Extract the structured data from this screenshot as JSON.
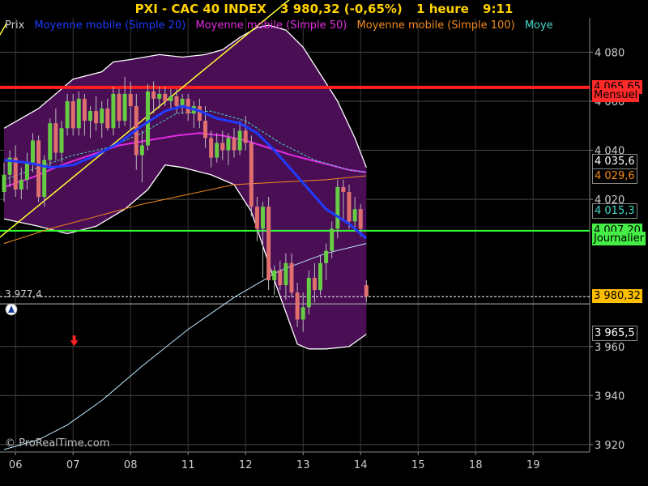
{
  "header": {
    "symbol": "PXI - CAC 40 INDEX",
    "price": "3 980,32 (-0,65%)",
    "timeframe": "1 heure",
    "time": "9:11"
  },
  "legend": {
    "items": [
      {
        "label": "Prix",
        "color": "#cccccc"
      },
      {
        "label": "Moyenne mobile (Simple 20)",
        "color": "#1f3cff"
      },
      {
        "label": "Moyenne mobile (Simple 50)",
        "color": "#e22be2"
      },
      {
        "label": "Moyenne mobile (Simple 100)",
        "color": "#f08a1e"
      },
      {
        "label": "Moye",
        "color": "#40d8c8"
      }
    ]
  },
  "copyright": "© ProRealTime.com",
  "price_labels": [
    {
      "text": "4 065,65",
      "value": 4065.65,
      "bg": "#ff2a2a",
      "fg": "#000000"
    },
    {
      "text": "Mensuel",
      "value": 4062.3,
      "bg": "#ff2a2a",
      "fg": "#000000"
    },
    {
      "text": "4 035,6",
      "value": 4035.6,
      "bg": "#000000",
      "fg": "#ffffff"
    },
    {
      "text": "4 029,6",
      "value": 4029.6,
      "bg": "#000000",
      "fg": "#f08a1e"
    },
    {
      "text": "4 015,3",
      "value": 4015.3,
      "bg": "#000000",
      "fg": "#40d8c8"
    },
    {
      "text": "4 007,20",
      "value": 4007.2,
      "bg": "#44ee44",
      "fg": "#000000"
    },
    {
      "text": "Journalier",
      "value": 4003.9,
      "bg": "#44ee44",
      "fg": "#000000"
    },
    {
      "text": "3 980,32",
      "value": 3980.32,
      "bg": "#ffbf00",
      "fg": "#000000"
    },
    {
      "text": "3 965,5",
      "value": 3965.5,
      "bg": "#000000",
      "fg": "#ffffff"
    }
  ],
  "left_marker": "3 977,4",
  "chart_data": {
    "type": "candlestick",
    "title": "PXI - CAC 40 INDEX",
    "ylim": [
      3917,
      4094
    ],
    "y_ticks": [
      3920,
      3940,
      3960,
      4020,
      4040,
      4060,
      4080
    ],
    "y_tick_labels": [
      "3 920",
      "3 940",
      "3 960",
      "4 020",
      "4 040",
      "4 060",
      "4 080"
    ],
    "x_ticks": [
      {
        "label": "06",
        "idx": 2
      },
      {
        "label": "07",
        "idx": 12
      },
      {
        "label": "08",
        "idx": 22
      },
      {
        "label": "11",
        "idx": 32
      },
      {
        "label": "12",
        "idx": 42
      },
      {
        "label": "13",
        "idx": 52
      },
      {
        "label": "14",
        "idx": 62
      },
      {
        "label": "15",
        "idx": 72
      },
      {
        "label": "18",
        "idx": 82
      },
      {
        "label": "19",
        "idx": 92
      }
    ],
    "candles": [
      {
        "o": 4023,
        "h": 4035,
        "l": 4019,
        "c": 4030
      },
      {
        "o": 4030,
        "h": 4040,
        "l": 4025,
        "c": 4037
      },
      {
        "o": 4037,
        "h": 4042,
        "l": 4021,
        "c": 4024
      },
      {
        "o": 4024,
        "h": 4033,
        "l": 4020,
        "c": 4028
      },
      {
        "o": 4028,
        "h": 4039,
        "l": 4024,
        "c": 4035
      },
      {
        "o": 4035,
        "h": 4047,
        "l": 4031,
        "c": 4044
      },
      {
        "o": 4044,
        "h": 4046,
        "l": 4019,
        "c": 4021
      },
      {
        "o": 4021,
        "h": 4038,
        "l": 4017,
        "c": 4036
      },
      {
        "o": 4036,
        "h": 4053,
        "l": 4033,
        "c": 4051
      },
      {
        "o": 4051,
        "h": 4057,
        "l": 4036,
        "c": 4039
      },
      {
        "o": 4039,
        "h": 4052,
        "l": 4035,
        "c": 4049
      },
      {
        "o": 4049,
        "h": 4063,
        "l": 4046,
        "c": 4060
      },
      {
        "o": 4060,
        "h": 4063,
        "l": 4046,
        "c": 4049
      },
      {
        "o": 4049,
        "h": 4064,
        "l": 4046,
        "c": 4061
      },
      {
        "o": 4061,
        "h": 4063,
        "l": 4046,
        "c": 4052
      },
      {
        "o": 4052,
        "h": 4058,
        "l": 4045,
        "c": 4056
      },
      {
        "o": 4056,
        "h": 4062,
        "l": 4048,
        "c": 4051
      },
      {
        "o": 4051,
        "h": 4060,
        "l": 4045,
        "c": 4057
      },
      {
        "o": 4057,
        "h": 4061,
        "l": 4048,
        "c": 4049
      },
      {
        "o": 4049,
        "h": 4066,
        "l": 4046,
        "c": 4063
      },
      {
        "o": 4063,
        "h": 4065,
        "l": 4049,
        "c": 4052
      },
      {
        "o": 4052,
        "h": 4070,
        "l": 4050,
        "c": 4063
      },
      {
        "o": 4063,
        "h": 4068,
        "l": 4048,
        "c": 4058
      },
      {
        "o": 4058,
        "h": 4063,
        "l": 4032,
        "c": 4038
      },
      {
        "o": 4038,
        "h": 4048,
        "l": 4027,
        "c": 4042
      },
      {
        "o": 4042,
        "h": 4067,
        "l": 4040,
        "c": 4064
      },
      {
        "o": 4064,
        "h": 4068,
        "l": 4055,
        "c": 4061
      },
      {
        "o": 4061,
        "h": 4066,
        "l": 4057,
        "c": 4063
      },
      {
        "o": 4063,
        "h": 4066,
        "l": 4058,
        "c": 4060
      },
      {
        "o": 4060,
        "h": 4065,
        "l": 4057,
        "c": 4062
      },
      {
        "o": 4062,
        "h": 4065,
        "l": 4055,
        "c": 4058
      },
      {
        "o": 4058,
        "h": 4063,
        "l": 4055,
        "c": 4061
      },
      {
        "o": 4061,
        "h": 4063,
        "l": 4052,
        "c": 4055
      },
      {
        "o": 4055,
        "h": 4060,
        "l": 4049,
        "c": 4058
      },
      {
        "o": 4058,
        "h": 4061,
        "l": 4049,
        "c": 4052
      },
      {
        "o": 4052,
        "h": 4058,
        "l": 4041,
        "c": 4045
      },
      {
        "o": 4045,
        "h": 4048,
        "l": 4033,
        "c": 4037
      },
      {
        "o": 4037,
        "h": 4047,
        "l": 4035,
        "c": 4043
      },
      {
        "o": 4043,
        "h": 4048,
        "l": 4036,
        "c": 4040
      },
      {
        "o": 4040,
        "h": 4047,
        "l": 4034,
        "c": 4045
      },
      {
        "o": 4045,
        "h": 4049,
        "l": 4037,
        "c": 4040
      },
      {
        "o": 4040,
        "h": 4052,
        "l": 4038,
        "c": 4048
      },
      {
        "o": 4048,
        "h": 4054,
        "l": 4040,
        "c": 4043
      },
      {
        "o": 4043,
        "h": 4046,
        "l": 4013,
        "c": 4017
      },
      {
        "o": 4017,
        "h": 4021,
        "l": 4003,
        "c": 4008
      },
      {
        "o": 4008,
        "h": 4019,
        "l": 3988,
        "c": 4017
      },
      {
        "o": 4017,
        "h": 4021,
        "l": 3983,
        "c": 3987
      },
      {
        "o": 3987,
        "h": 3993,
        "l": 3981,
        "c": 3991
      },
      {
        "o": 3991,
        "h": 3995,
        "l": 3983,
        "c": 3985
      },
      {
        "o": 3985,
        "h": 3998,
        "l": 3979,
        "c": 3994
      },
      {
        "o": 3994,
        "h": 3998,
        "l": 3980,
        "c": 3982
      },
      {
        "o": 3982,
        "h": 3986,
        "l": 3968,
        "c": 3971
      },
      {
        "o": 3971,
        "h": 3982,
        "l": 3966,
        "c": 3976
      },
      {
        "o": 3976,
        "h": 3991,
        "l": 3973,
        "c": 3988
      },
      {
        "o": 3988,
        "h": 3994,
        "l": 3978,
        "c": 3983
      },
      {
        "o": 3983,
        "h": 3997,
        "l": 3981,
        "c": 3994
      },
      {
        "o": 3994,
        "h": 4002,
        "l": 3987,
        "c": 3999
      },
      {
        "o": 3999,
        "h": 4011,
        "l": 3996,
        "c": 4008
      },
      {
        "o": 4008,
        "h": 4028,
        "l": 4004,
        "c": 4025
      },
      {
        "o": 4025,
        "h": 4028,
        "l": 4012,
        "c": 4023
      },
      {
        "o": 4023,
        "h": 4026,
        "l": 4008,
        "c": 4011
      },
      {
        "o": 4011,
        "h": 4021,
        "l": 4007,
        "c": 4016
      },
      {
        "o": 4016,
        "h": 4018,
        "l": 4005,
        "c": 4008
      },
      {
        "o": 3985,
        "h": 3987,
        "l": 3978,
        "c": 3980.32
      }
    ],
    "bollinger_upper": [
      {
        "i": 0,
        "v": 4049
      },
      {
        "i": 6,
        "v": 4057
      },
      {
        "i": 12,
        "v": 4069
      },
      {
        "i": 17,
        "v": 4072
      },
      {
        "i": 19,
        "v": 4076
      },
      {
        "i": 22,
        "v": 4077
      },
      {
        "i": 27,
        "v": 4079
      },
      {
        "i": 31,
        "v": 4078
      },
      {
        "i": 35,
        "v": 4079
      },
      {
        "i": 38,
        "v": 4081
      },
      {
        "i": 41,
        "v": 4086
      },
      {
        "i": 44,
        "v": 4090
      },
      {
        "i": 46,
        "v": 4091
      },
      {
        "i": 49,
        "v": 4089
      },
      {
        "i": 52,
        "v": 4082
      },
      {
        "i": 55,
        "v": 4071
      },
      {
        "i": 58,
        "v": 4060
      },
      {
        "i": 61,
        "v": 4045
      },
      {
        "i": 63,
        "v": 4033
      }
    ],
    "bollinger_lower": [
      {
        "i": 0,
        "v": 4012
      },
      {
        "i": 6,
        "v": 4009
      },
      {
        "i": 11,
        "v": 4006
      },
      {
        "i": 16,
        "v": 4009
      },
      {
        "i": 21,
        "v": 4016
      },
      {
        "i": 25,
        "v": 4024
      },
      {
        "i": 28,
        "v": 4034
      },
      {
        "i": 31,
        "v": 4033
      },
      {
        "i": 36,
        "v": 4030
      },
      {
        "i": 40,
        "v": 4026
      },
      {
        "i": 43,
        "v": 4015
      },
      {
        "i": 45,
        "v": 4001
      },
      {
        "i": 47,
        "v": 3987
      },
      {
        "i": 49,
        "v": 3974
      },
      {
        "i": 51,
        "v": 3961
      },
      {
        "i": 53,
        "v": 3959
      },
      {
        "i": 56,
        "v": 3959
      },
      {
        "i": 60,
        "v": 3960
      },
      {
        "i": 63,
        "v": 3965
      }
    ],
    "ma20": [
      {
        "i": 0,
        "v": 4036
      },
      {
        "i": 4,
        "v": 4035
      },
      {
        "i": 8,
        "v": 4033
      },
      {
        "i": 12,
        "v": 4034
      },
      {
        "i": 16,
        "v": 4038
      },
      {
        "i": 20,
        "v": 4043
      },
      {
        "i": 24,
        "v": 4050
      },
      {
        "i": 28,
        "v": 4056
      },
      {
        "i": 31,
        "v": 4058
      },
      {
        "i": 34,
        "v": 4056
      },
      {
        "i": 37,
        "v": 4053
      },
      {
        "i": 41,
        "v": 4051
      },
      {
        "i": 44,
        "v": 4047
      },
      {
        "i": 47,
        "v": 4040
      },
      {
        "i": 50,
        "v": 4032
      },
      {
        "i": 53,
        "v": 4024
      },
      {
        "i": 56,
        "v": 4016
      },
      {
        "i": 60,
        "v": 4010
      },
      {
        "i": 63,
        "v": 4004
      }
    ],
    "ma50": [
      {
        "i": 0,
        "v": 4025
      },
      {
        "i": 5,
        "v": 4029
      },
      {
        "i": 10,
        "v": 4034
      },
      {
        "i": 15,
        "v": 4038
      },
      {
        "i": 20,
        "v": 4042
      },
      {
        "i": 25,
        "v": 4044
      },
      {
        "i": 30,
        "v": 4046
      },
      {
        "i": 34,
        "v": 4047
      },
      {
        "i": 38,
        "v": 4046
      },
      {
        "i": 42,
        "v": 4044
      },
      {
        "i": 46,
        "v": 4041
      },
      {
        "i": 50,
        "v": 4038
      },
      {
        "i": 55,
        "v": 4035
      },
      {
        "i": 60,
        "v": 4032
      },
      {
        "i": 63,
        "v": 4031
      }
    ],
    "ma100": [
      {
        "i": 0,
        "v": 4002
      },
      {
        "i": 8,
        "v": 4008
      },
      {
        "i": 16,
        "v": 4013
      },
      {
        "i": 24,
        "v": 4018
      },
      {
        "i": 32,
        "v": 4022
      },
      {
        "i": 40,
        "v": 4026
      },
      {
        "i": 48,
        "v": 4027
      },
      {
        "i": 56,
        "v": 4028
      },
      {
        "i": 63,
        "v": 4029.6
      }
    ],
    "ma_cyan": [
      {
        "i": 0,
        "v": 3918
      },
      {
        "i": 6,
        "v": 3922
      },
      {
        "i": 11,
        "v": 3928
      },
      {
        "i": 17,
        "v": 3938
      },
      {
        "i": 24,
        "v": 3952
      },
      {
        "i": 32,
        "v": 3967
      },
      {
        "i": 40,
        "v": 3980
      },
      {
        "i": 48,
        "v": 3991
      },
      {
        "i": 56,
        "v": 3998
      },
      {
        "i": 63,
        "v": 4002
      }
    ],
    "ma_dashed": [
      {
        "i": 0,
        "v": 4028
      },
      {
        "i": 6,
        "v": 4033
      },
      {
        "i": 12,
        "v": 4038
      },
      {
        "i": 18,
        "v": 4041
      },
      {
        "i": 24,
        "v": 4047
      },
      {
        "i": 30,
        "v": 4055
      },
      {
        "i": 36,
        "v": 4056
      },
      {
        "i": 42,
        "v": 4052
      },
      {
        "i": 48,
        "v": 4043
      },
      {
        "i": 54,
        "v": 4036
      },
      {
        "i": 60,
        "v": 4032
      },
      {
        "i": 63,
        "v": 4031
      }
    ],
    "trendline": [
      {
        "i": -1,
        "v": 4004
      },
      {
        "i": 52,
        "v": 4106
      }
    ],
    "trendline2": [
      {
        "i": -1,
        "v": 4086
      },
      {
        "i": 0.5,
        "v": 4092
      }
    ],
    "h_lines": [
      {
        "v": 4065.65,
        "color": "#ff2020",
        "width": 4
      },
      {
        "v": 4007.2,
        "color": "#33ff33",
        "width": 2
      },
      {
        "v": 3980.32,
        "color": "#ffffff",
        "width": 1,
        "dash": "3,2"
      },
      {
        "v": 3977.4,
        "color": "#bbbbbb",
        "width": 1
      }
    ],
    "markers": [
      {
        "type": "down-arrow",
        "i": 12.2,
        "v": 3962.5,
        "color": "#ff2020"
      }
    ]
  }
}
